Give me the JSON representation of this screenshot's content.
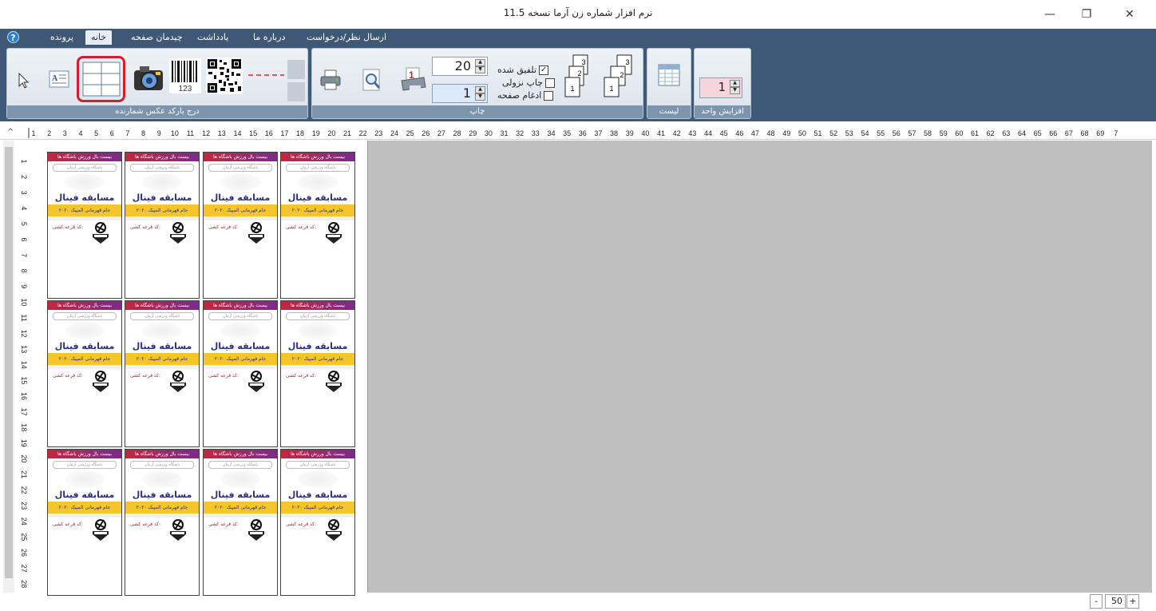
{
  "window": {
    "title": "نرم افزار شماره زن آرما نسخه 11.5",
    "minimize": "—",
    "restore": "❐",
    "close": "✕"
  },
  "menu": {
    "help": "?",
    "items": [
      "پرونده",
      "خانه",
      "چیدمان صفحه",
      "یادداشت",
      "درباره ما",
      "ارسال نظر/درخواست"
    ],
    "active": "خانه"
  },
  "ribbon": {
    "insert_group_label": "درج بارکد  عکس   شمارنده",
    "barcode_number": "123",
    "print_group_label": "چاپ",
    "copies_value": "20",
    "start_value": "1",
    "options": [
      {
        "label": "تلفیق شده",
        "checked": true
      },
      {
        "label": "چاپ نزولی",
        "checked": false
      },
      {
        "label": "ادغام صفحه",
        "checked": false
      }
    ],
    "order_icons": [
      "3",
      "2",
      "1",
      "3",
      "2",
      "1"
    ],
    "list_group_label": "لیست",
    "increment_group_label": "افزایش واحد",
    "increment_value": "1"
  },
  "ruler": {
    "corner": "^",
    "horizontal": [
      "1",
      "2",
      "3",
      "4",
      "5",
      "6",
      "7",
      "8",
      "9",
      "10",
      "11",
      "12",
      "13",
      "14",
      "15",
      "16",
      "17",
      "18",
      "19",
      "20",
      "21",
      "22",
      "23",
      "24",
      "25",
      "26",
      "27",
      "28",
      "29",
      "30",
      "31",
      "32",
      "33",
      "34",
      "35",
      "36",
      "37",
      "38",
      "39",
      "40",
      "41",
      "42",
      "43",
      "44",
      "45",
      "46",
      "47",
      "48",
      "49",
      "50",
      "51",
      "52",
      "53",
      "54",
      "55",
      "56",
      "57",
      "58",
      "59",
      "60",
      "61",
      "62",
      "63",
      "64",
      "65",
      "66",
      "67",
      "68",
      "69",
      "7"
    ],
    "vertical": [
      "1",
      "2",
      "3",
      "4",
      "5",
      "6",
      "7",
      "8",
      "9",
      "10",
      "11",
      "12",
      "13",
      "14",
      "15",
      "16",
      "17",
      "18",
      "19",
      "20",
      "21",
      "22",
      "23",
      "24",
      "25",
      "26",
      "27",
      "28"
    ]
  },
  "ticket": {
    "header": "بیست بال ورزش باشگاه ها",
    "sub": "باشگاه ورزشی آرمان",
    "title": "مسابقه فینال",
    "band": "جام قهرمانی المپیک ۲۰۲۰",
    "code": "کد قرعه کشی:"
  },
  "zoom": {
    "minus": "-",
    "value": "50",
    "plus": "+"
  }
}
